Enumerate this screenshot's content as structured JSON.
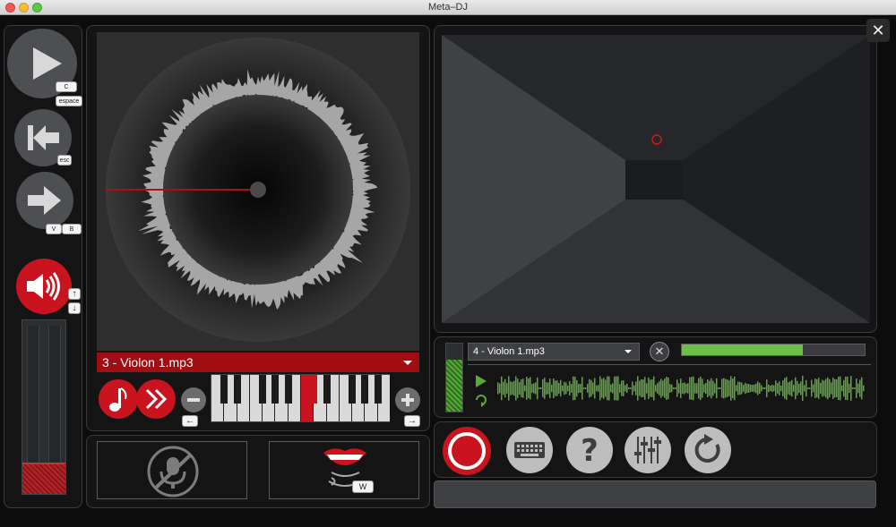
{
  "window": {
    "title": "Meta–DJ"
  },
  "left_controls": {
    "play_key_1": "C",
    "play_key_2": "espace",
    "back_key": "esc",
    "next_key_1": "V",
    "next_key_2": "B",
    "volume_up_key": "↑",
    "volume_down_key": "↓",
    "volume_level": 0.18
  },
  "turntable": {
    "track_label": "3 - Violon 1.mp3",
    "keys_left": "←",
    "keys_right": "→"
  },
  "player2": {
    "track_label": "4 - Violon 1.mp3",
    "progress": 0.66
  },
  "speech": {
    "key": "W"
  },
  "colors": {
    "accent_red": "#c9141f",
    "green": "#5aa83a",
    "panel": "#141414"
  },
  "icons": {
    "play": "play-icon",
    "back": "skip-back-icon",
    "next": "arrow-right-icon",
    "volume": "speaker-icon",
    "mute_mic": "mic-off-icon",
    "mouth": "mouth-icon",
    "record": "record-icon",
    "keyboard": "keyboard-icon",
    "help": "help-icon",
    "mixer": "sliders-icon",
    "reset": "reset-icon",
    "close": "close-icon"
  }
}
